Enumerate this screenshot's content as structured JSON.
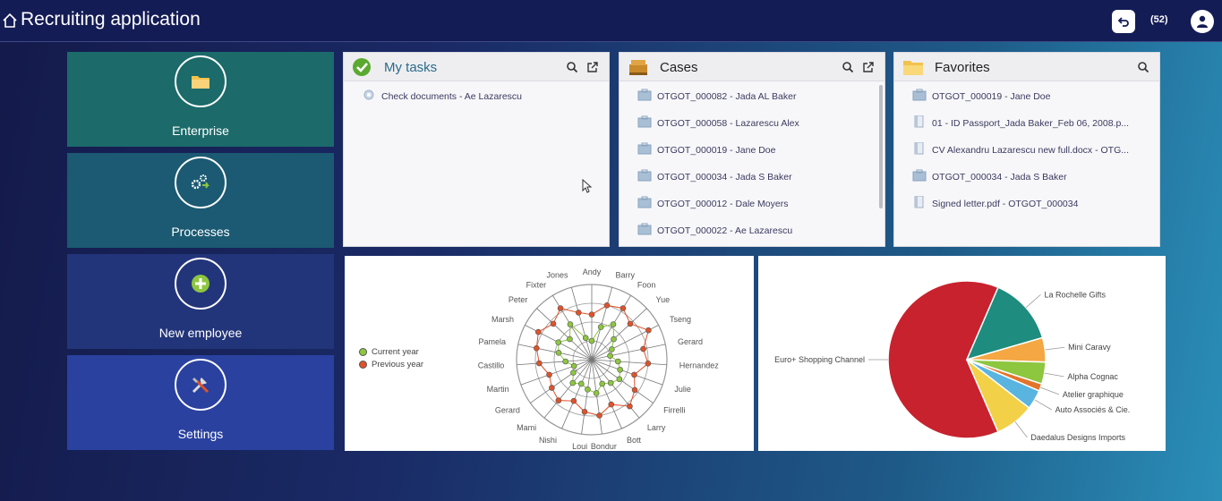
{
  "header": {
    "title": "Recruiting application",
    "badge": "(52)"
  },
  "tiles": [
    {
      "label": "Enterprise",
      "icon": "folder-icon",
      "color": "#1c6a6a"
    },
    {
      "label": "Processes",
      "icon": "gears-icon",
      "color": "#1b5a72"
    },
    {
      "label": "New employee",
      "icon": "add-icon",
      "color": "#23357a"
    },
    {
      "label": "Settings",
      "icon": "tools-icon",
      "color": "#2a41a0"
    }
  ],
  "my_tasks": {
    "title": "My tasks",
    "items": [
      "Check documents - Ae Lazarescu"
    ]
  },
  "cases": {
    "title": "Cases",
    "items": [
      "OTGOT_000082 - Jada AL Baker",
      "OTGOT_000058 - Lazarescu Alex",
      "OTGOT_000019 - Jane Doe",
      "OTGOT_000034 - Jada S Baker",
      "OTGOT_000012 - Dale Moyers",
      "OTGOT_000022 - Ae Lazarescu"
    ]
  },
  "favorites": {
    "title": "Favorites",
    "items": [
      {
        "text": "OTGOT_000019 - Jane Doe",
        "icon": "case-icon"
      },
      {
        "text": "01 - ID Passport_Jada Baker_Feb 06, 2008.p...",
        "icon": "document-icon"
      },
      {
        "text": "CV Alexandru Lazarescu new full.docx - OTG...",
        "icon": "document-icon"
      },
      {
        "text": "OTGOT_000034 - Jada S Baker",
        "icon": "case-icon"
      },
      {
        "text": "Signed letter.pdf - OTGOT_000034",
        "icon": "document-icon"
      }
    ]
  },
  "chart_data": [
    {
      "type": "radar",
      "categories": [
        "Andy",
        "Barry",
        "Foon",
        "Yue",
        "Tseng",
        "Gerard",
        "Hernandez",
        "Julie",
        "Firrelli",
        "Larry",
        "Bott",
        "Bondur",
        "Loui",
        "Nishi",
        "Mami",
        "Gerard",
        "Martin",
        "Castillo",
        "Pamela",
        "Marsh",
        "Peter",
        "Fixter",
        "Jones"
      ],
      "series": [
        {
          "name": "Current year",
          "color": "#8dc63f",
          "values": [
            25,
            45,
            55,
            40,
            30,
            25,
            35,
            40,
            45,
            40,
            35,
            45,
            40,
            35,
            40,
            30,
            25,
            35,
            45,
            50,
            40,
            55,
            30
          ]
        },
        {
          "name": "Previous year",
          "color": "#e0522a",
          "values": [
            60,
            75,
            80,
            70,
            85,
            70,
            75,
            60,
            70,
            80,
            65,
            75,
            70,
            60,
            70,
            65,
            60,
            70,
            75,
            80,
            70,
            80,
            65
          ]
        }
      ],
      "legend": "left"
    },
    {
      "type": "pie",
      "series": [
        {
          "name": "Euro+ Shopping Channel",
          "value": 63,
          "color": "#c8222e"
        },
        {
          "name": "La Rochelle Gifts",
          "value": 14,
          "color": "#1e8c7e"
        },
        {
          "name": "Mini Caravy",
          "value": 5,
          "color": "#f4a742"
        },
        {
          "name": "Alpha Cognac",
          "value": 4.5,
          "color": "#8dc63f"
        },
        {
          "name": "Atelier graphique",
          "value": 1.5,
          "color": "#e3742c"
        },
        {
          "name": "Auto Associés & Cie.",
          "value": 4,
          "color": "#5ab4e0"
        },
        {
          "name": "Daedalus Designs Imports",
          "value": 8,
          "color": "#f2d048"
        }
      ]
    }
  ]
}
